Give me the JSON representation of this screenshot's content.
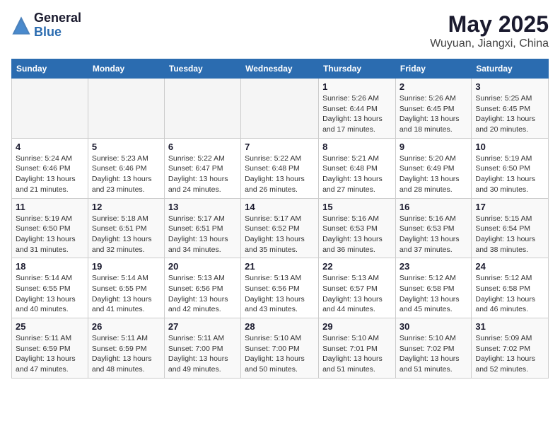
{
  "header": {
    "logo_general": "General",
    "logo_blue": "Blue",
    "month": "May 2025",
    "location": "Wuyuan, Jiangxi, China"
  },
  "weekdays": [
    "Sunday",
    "Monday",
    "Tuesday",
    "Wednesday",
    "Thursday",
    "Friday",
    "Saturday"
  ],
  "weeks": [
    [
      {
        "day": "",
        "info": ""
      },
      {
        "day": "",
        "info": ""
      },
      {
        "day": "",
        "info": ""
      },
      {
        "day": "",
        "info": ""
      },
      {
        "day": "1",
        "info": "Sunrise: 5:26 AM\nSunset: 6:44 PM\nDaylight: 13 hours and 17 minutes."
      },
      {
        "day": "2",
        "info": "Sunrise: 5:26 AM\nSunset: 6:45 PM\nDaylight: 13 hours and 18 minutes."
      },
      {
        "day": "3",
        "info": "Sunrise: 5:25 AM\nSunset: 6:45 PM\nDaylight: 13 hours and 20 minutes."
      }
    ],
    [
      {
        "day": "4",
        "info": "Sunrise: 5:24 AM\nSunset: 6:46 PM\nDaylight: 13 hours and 21 minutes."
      },
      {
        "day": "5",
        "info": "Sunrise: 5:23 AM\nSunset: 6:46 PM\nDaylight: 13 hours and 23 minutes."
      },
      {
        "day": "6",
        "info": "Sunrise: 5:22 AM\nSunset: 6:47 PM\nDaylight: 13 hours and 24 minutes."
      },
      {
        "day": "7",
        "info": "Sunrise: 5:22 AM\nSunset: 6:48 PM\nDaylight: 13 hours and 26 minutes."
      },
      {
        "day": "8",
        "info": "Sunrise: 5:21 AM\nSunset: 6:48 PM\nDaylight: 13 hours and 27 minutes."
      },
      {
        "day": "9",
        "info": "Sunrise: 5:20 AM\nSunset: 6:49 PM\nDaylight: 13 hours and 28 minutes."
      },
      {
        "day": "10",
        "info": "Sunrise: 5:19 AM\nSunset: 6:50 PM\nDaylight: 13 hours and 30 minutes."
      }
    ],
    [
      {
        "day": "11",
        "info": "Sunrise: 5:19 AM\nSunset: 6:50 PM\nDaylight: 13 hours and 31 minutes."
      },
      {
        "day": "12",
        "info": "Sunrise: 5:18 AM\nSunset: 6:51 PM\nDaylight: 13 hours and 32 minutes."
      },
      {
        "day": "13",
        "info": "Sunrise: 5:17 AM\nSunset: 6:51 PM\nDaylight: 13 hours and 34 minutes."
      },
      {
        "day": "14",
        "info": "Sunrise: 5:17 AM\nSunset: 6:52 PM\nDaylight: 13 hours and 35 minutes."
      },
      {
        "day": "15",
        "info": "Sunrise: 5:16 AM\nSunset: 6:53 PM\nDaylight: 13 hours and 36 minutes."
      },
      {
        "day": "16",
        "info": "Sunrise: 5:16 AM\nSunset: 6:53 PM\nDaylight: 13 hours and 37 minutes."
      },
      {
        "day": "17",
        "info": "Sunrise: 5:15 AM\nSunset: 6:54 PM\nDaylight: 13 hours and 38 minutes."
      }
    ],
    [
      {
        "day": "18",
        "info": "Sunrise: 5:14 AM\nSunset: 6:55 PM\nDaylight: 13 hours and 40 minutes."
      },
      {
        "day": "19",
        "info": "Sunrise: 5:14 AM\nSunset: 6:55 PM\nDaylight: 13 hours and 41 minutes."
      },
      {
        "day": "20",
        "info": "Sunrise: 5:13 AM\nSunset: 6:56 PM\nDaylight: 13 hours and 42 minutes."
      },
      {
        "day": "21",
        "info": "Sunrise: 5:13 AM\nSunset: 6:56 PM\nDaylight: 13 hours and 43 minutes."
      },
      {
        "day": "22",
        "info": "Sunrise: 5:13 AM\nSunset: 6:57 PM\nDaylight: 13 hours and 44 minutes."
      },
      {
        "day": "23",
        "info": "Sunrise: 5:12 AM\nSunset: 6:58 PM\nDaylight: 13 hours and 45 minutes."
      },
      {
        "day": "24",
        "info": "Sunrise: 5:12 AM\nSunset: 6:58 PM\nDaylight: 13 hours and 46 minutes."
      }
    ],
    [
      {
        "day": "25",
        "info": "Sunrise: 5:11 AM\nSunset: 6:59 PM\nDaylight: 13 hours and 47 minutes."
      },
      {
        "day": "26",
        "info": "Sunrise: 5:11 AM\nSunset: 6:59 PM\nDaylight: 13 hours and 48 minutes."
      },
      {
        "day": "27",
        "info": "Sunrise: 5:11 AM\nSunset: 7:00 PM\nDaylight: 13 hours and 49 minutes."
      },
      {
        "day": "28",
        "info": "Sunrise: 5:10 AM\nSunset: 7:00 PM\nDaylight: 13 hours and 50 minutes."
      },
      {
        "day": "29",
        "info": "Sunrise: 5:10 AM\nSunset: 7:01 PM\nDaylight: 13 hours and 51 minutes."
      },
      {
        "day": "30",
        "info": "Sunrise: 5:10 AM\nSunset: 7:02 PM\nDaylight: 13 hours and 51 minutes."
      },
      {
        "day": "31",
        "info": "Sunrise: 5:09 AM\nSunset: 7:02 PM\nDaylight: 13 hours and 52 minutes."
      }
    ]
  ]
}
